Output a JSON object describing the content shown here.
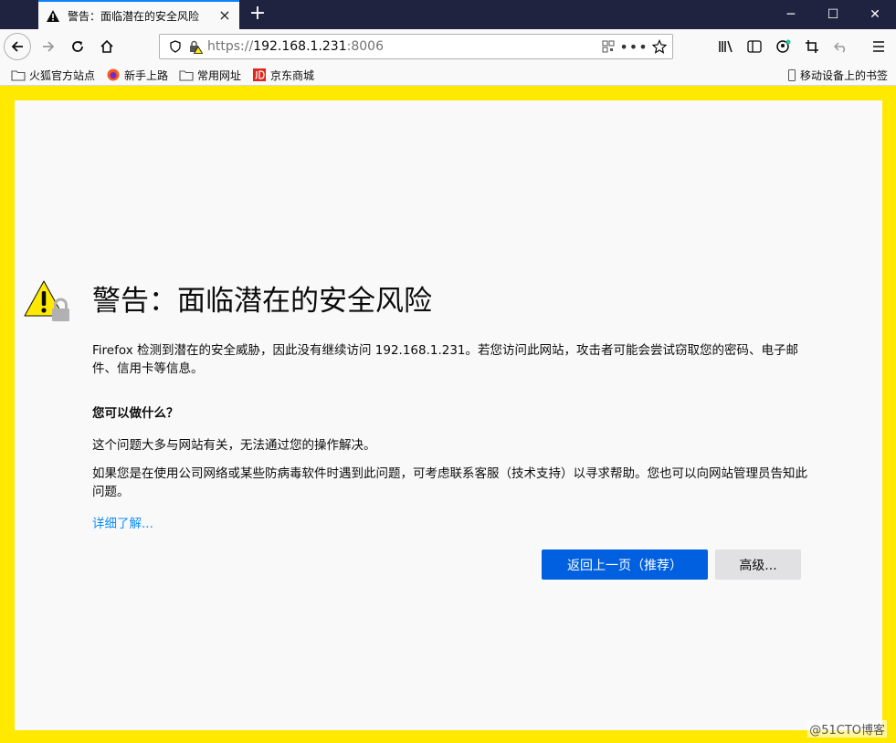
{
  "tab": {
    "title": "警告：面临潜在的安全风险",
    "new_tab": "+"
  },
  "window": {
    "minimize": "─",
    "maximize": "☐",
    "close": "✕"
  },
  "urlbar": {
    "scheme": "https://",
    "host": "192.168.1.231",
    "port": ":8006"
  },
  "bookmarks": {
    "items": [
      "火狐官方站点",
      "新手上路",
      "常用网址",
      "京东商城"
    ],
    "mobile": "移动设备上的书签"
  },
  "page": {
    "title": "警告：面临潜在的安全风险",
    "description": "Firefox 检测到潜在的安全威胁，因此没有继续访问 192.168.1.231。若您访问此网站，攻击者可能会尝试窃取您的密码、电子邮件、信用卡等信息。",
    "what_heading": "您可以做什么？",
    "para1": "这个问题大多与网站有关，无法通过您的操作解决。",
    "para2": "如果您是在使用公司网络或某些防病毒软件时遇到此问题，可考虑联系客服（技术支持）以寻求帮助。您也可以向网站管理员告知此问题。",
    "learn_more": "详细了解...",
    "go_back": "返回上一页（推荐）",
    "advanced": "高级..."
  },
  "watermark": "@51CTO博客",
  "colors": {
    "accent": "#0060df",
    "frame": "#ffe900",
    "link": "#0a8dff"
  }
}
